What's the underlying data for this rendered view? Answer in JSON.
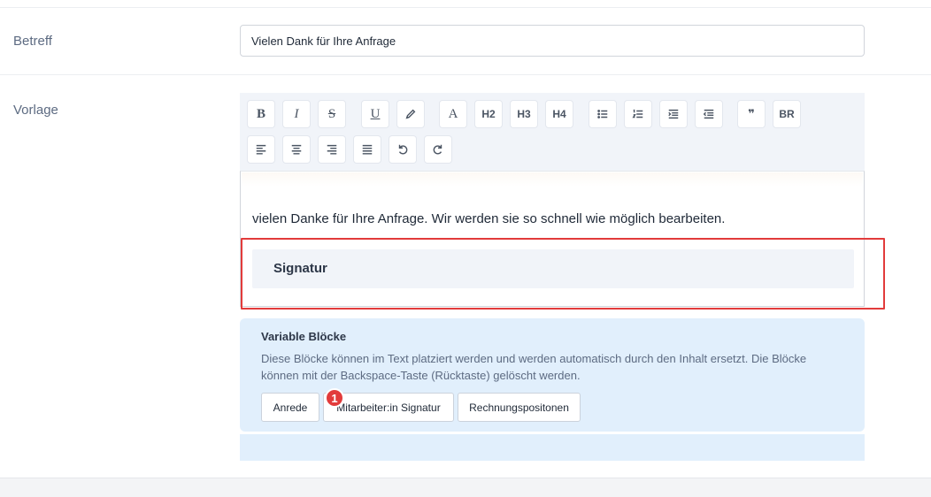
{
  "form": {
    "subject": {
      "label": "Betreff",
      "value": "Vielen Dank für Ihre Anfrage"
    },
    "template": {
      "label": "Vorlage"
    }
  },
  "toolbar": {
    "row1": [
      {
        "name": "bold-button",
        "icon": "bold-icon",
        "text": "B"
      },
      {
        "name": "italic-button",
        "icon": "italic-icon",
        "text": "I"
      },
      {
        "name": "strikethrough-button",
        "icon": "strikethrough-icon",
        "text": "S"
      },
      {
        "name": "underline-button",
        "icon": "underline-icon",
        "text": "U"
      },
      {
        "name": "highlight-button",
        "icon": "pen-icon",
        "text": ""
      },
      {
        "name": "font-button",
        "icon": "font-icon",
        "text": "A"
      },
      {
        "name": "h2-button",
        "icon": "",
        "text": "H2"
      },
      {
        "name": "h3-button",
        "icon": "",
        "text": "H3"
      },
      {
        "name": "h4-button",
        "icon": "",
        "text": "H4"
      },
      {
        "name": "bullet-list-button",
        "icon": "bullet-list-icon",
        "text": ""
      },
      {
        "name": "ordered-list-button",
        "icon": "ordered-list-icon",
        "text": ""
      },
      {
        "name": "indent-button",
        "icon": "indent-icon",
        "text": ""
      },
      {
        "name": "outdent-button",
        "icon": "outdent-icon",
        "text": ""
      },
      {
        "name": "blockquote-button",
        "icon": "quote-icon",
        "text": "❞"
      },
      {
        "name": "line-break-button",
        "icon": "",
        "text": "BR"
      }
    ],
    "row2": [
      {
        "name": "align-left-button",
        "icon": "align-left-icon",
        "text": ""
      },
      {
        "name": "align-center-button",
        "icon": "align-center-icon",
        "text": ""
      },
      {
        "name": "align-right-button",
        "icon": "align-right-icon",
        "text": ""
      },
      {
        "name": "align-justify-button",
        "icon": "align-justify-icon",
        "text": ""
      },
      {
        "name": "undo-button",
        "icon": "undo-icon",
        "text": ""
      },
      {
        "name": "redo-button",
        "icon": "redo-icon",
        "text": ""
      }
    ]
  },
  "editor": {
    "body_text": "vielen Danke für Ihre Anfrage. Wir werden sie so schnell wie möglich bearbeiten.",
    "signature_block": "Signatur"
  },
  "variables": {
    "title": "Variable Blöcke",
    "description": "Diese Blöcke können im Text platziert werden und werden automatisch durch den Inhalt ersetzt. Die Blöcke können mit der Backspace-Taste (Rücktaste) gelöscht werden.",
    "buttons": [
      "Anrede",
      "Mitarbeiter:in Signatur",
      "Rechnungspositonen"
    ],
    "badge": "1"
  },
  "colors": {
    "highlight": "#e23b3b",
    "panel": "#e1effc",
    "toolbar": "#f1f4f9"
  }
}
